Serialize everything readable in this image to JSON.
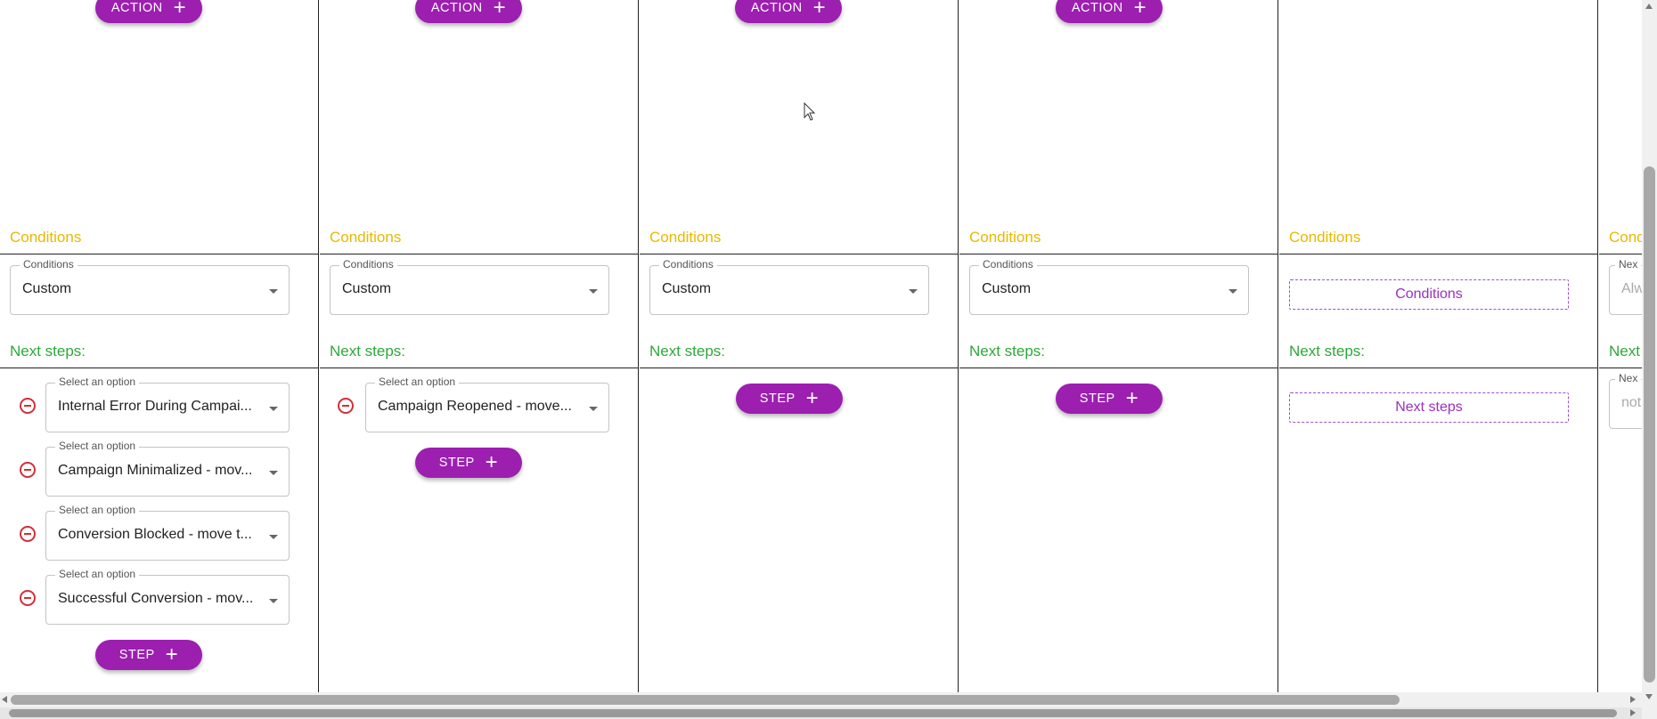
{
  "action_label": "ACTION",
  "step_label": "STEP",
  "conditions_section": "Conditions",
  "next_section": "Next steps:",
  "conditions_field_label": "Conditions",
  "conditions_field_value": "Custom",
  "option_label": "Select an option",
  "col1": {
    "options": [
      "Internal Error During Campai...",
      "Campaign Minimalized - mov...",
      "Conversion Blocked - move t...",
      "Successful Conversion - mov..."
    ]
  },
  "col2": {
    "options": [
      "Campaign Reopened - move..."
    ]
  },
  "col5": {
    "conditions_placeholder": "Conditions",
    "next_steps_placeholder": "Next steps"
  },
  "col6": {
    "section_fragment": "Cond",
    "next_fragment": "Next",
    "field_label_fragment": "Nex",
    "field_value_fragment": "Alw",
    "next_field_label_fragment": "Nex",
    "next_field_value_fragment": "not"
  },
  "colors": {
    "accent": "#9c1fb0",
    "conditions": "#e8b800",
    "next_steps": "#2ea83a",
    "remove": "#d0303a"
  }
}
